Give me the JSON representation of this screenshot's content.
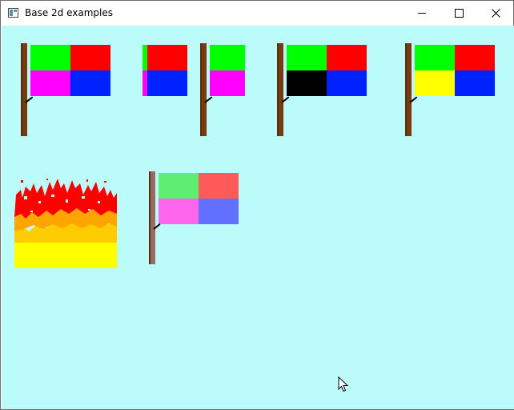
{
  "window": {
    "title": "Base 2d examples",
    "icons": {
      "app": "app-window-icon",
      "minimize": "minimize-icon",
      "maximize": "maximize-icon",
      "close": "close-icon"
    }
  },
  "canvas": {
    "background": "#bbfcfb"
  },
  "flags": [
    {
      "name": "flag-1",
      "colors": [
        "#00ff00",
        "#ff0000",
        "#ff00ff",
        "#0022ff"
      ]
    },
    {
      "name": "flag-2",
      "colors": [
        "#00ff00",
        "#ff0000",
        "#ff00ff",
        "#0022ff"
      ]
    },
    {
      "name": "flag-3",
      "colors": [
        "#00ff00",
        "#ff00ff"
      ]
    },
    {
      "name": "flag-4",
      "colors": [
        "#00ff00",
        "#ff0000",
        "#000000",
        "#0022ff"
      ]
    },
    {
      "name": "flag-5",
      "colors": [
        "#00ff00",
        "#ff0000",
        "#ffff00",
        "#0022ff"
      ]
    },
    {
      "name": "textured-flag",
      "colors": [
        "#5eee72",
        "#ff5a5a",
        "#ff66ee",
        "#6270ff"
      ]
    }
  ],
  "fire": {
    "colors": [
      "#ff0000",
      "#ffa500",
      "#ffcc00",
      "#ffff00"
    ]
  },
  "pole_color": "#7a3a10"
}
